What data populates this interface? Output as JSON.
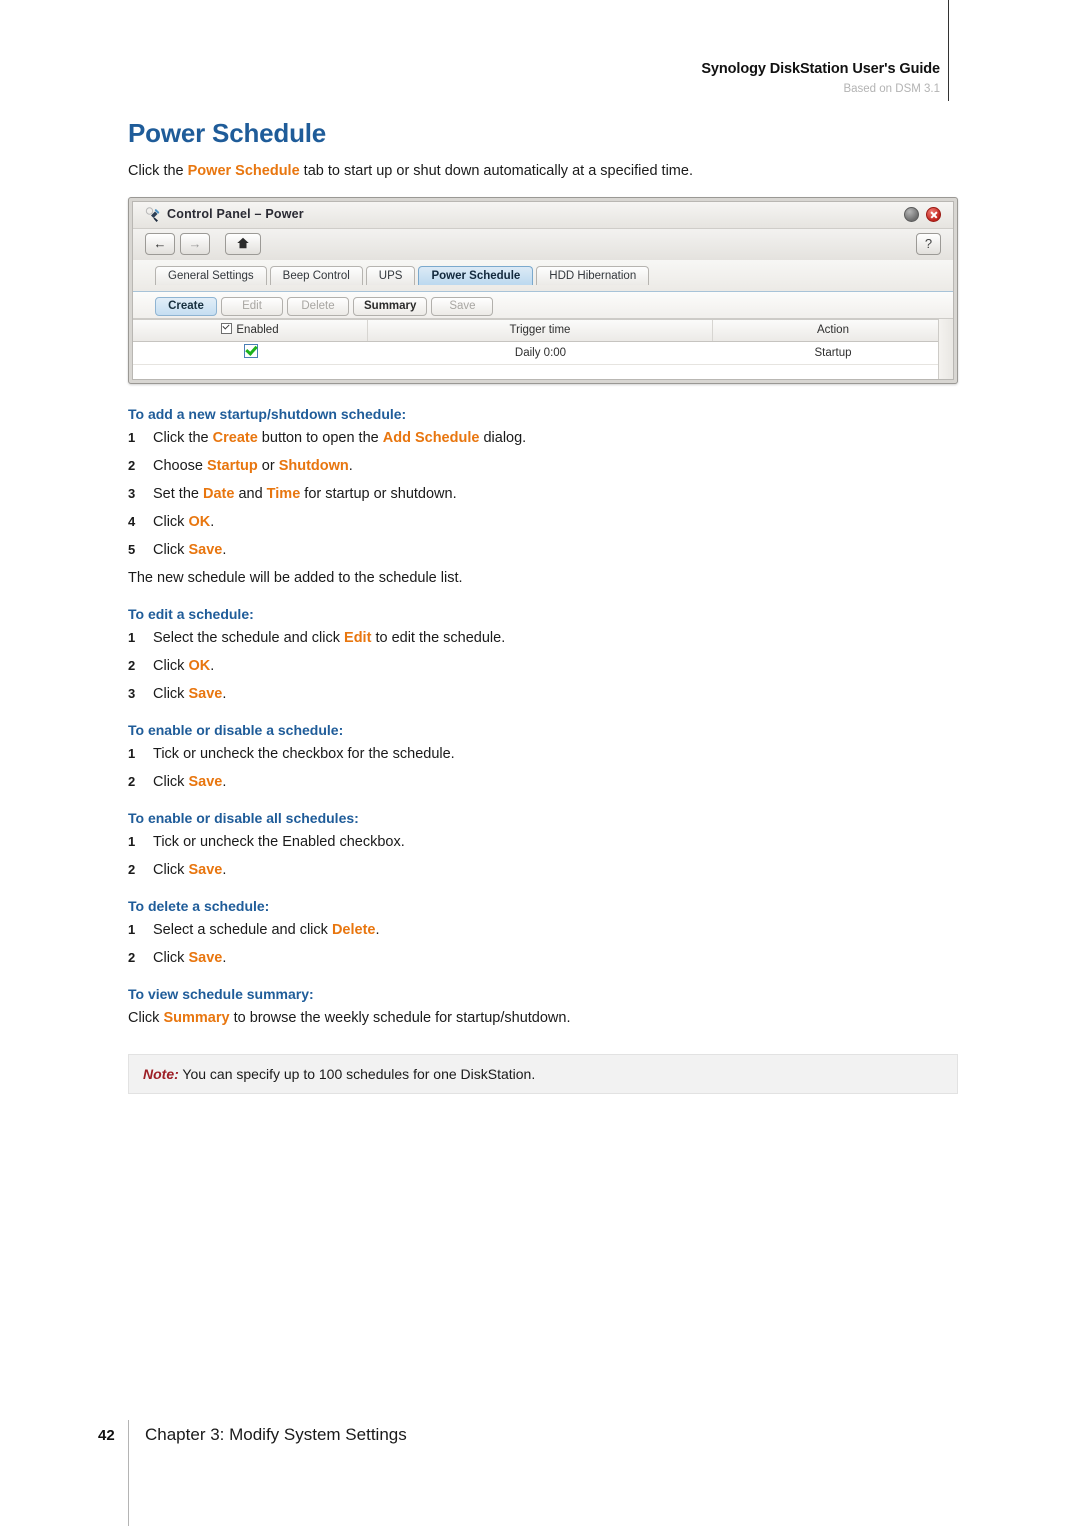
{
  "header": {
    "title": "Synology DiskStation User's Guide",
    "subtitle": "Based on DSM 3.1"
  },
  "page": {
    "title": "Power Schedule",
    "intro_pre": "Click the ",
    "intro_hl": "Power Schedule",
    "intro_post": " tab to start up or shut down automatically at a specified time."
  },
  "screenshot": {
    "window_title": "Control Panel – Power",
    "window_icon": "power-plug-icon",
    "nav": {
      "back": "←",
      "forward": "→",
      "home": "⌂",
      "help": "?"
    },
    "window_buttons": {
      "minimize": "minimize-icon",
      "close": "close-icon"
    },
    "tabs": [
      {
        "label": "General Settings",
        "active": false
      },
      {
        "label": "Beep Control",
        "active": false
      },
      {
        "label": "UPS",
        "active": false
      },
      {
        "label": "Power Schedule",
        "active": true
      },
      {
        "label": "HDD Hibernation",
        "active": false
      }
    ],
    "toolbar": [
      {
        "label": "Create",
        "state": "primary"
      },
      {
        "label": "Edit",
        "state": "disabled"
      },
      {
        "label": "Delete",
        "state": "disabled"
      },
      {
        "label": "Summary",
        "state": "bold"
      },
      {
        "label": "Save",
        "state": "disabled"
      }
    ],
    "grid": {
      "columns": [
        "Enabled",
        "Trigger time",
        "Action"
      ],
      "rows": [
        {
          "enabled": true,
          "trigger_time": "Daily 0:00",
          "action": "Startup"
        }
      ]
    }
  },
  "sections": [
    {
      "heading": "To add a new startup/shutdown schedule:",
      "steps": [
        {
          "num": "1",
          "parts": [
            {
              "t": "Click the ",
              "hl": false
            },
            {
              "t": "Create",
              "hl": true
            },
            {
              "t": " button to open the ",
              "hl": false
            },
            {
              "t": "Add Schedule",
              "hl": true
            },
            {
              "t": " dialog.",
              "hl": false
            }
          ]
        },
        {
          "num": "2",
          "parts": [
            {
              "t": "Choose ",
              "hl": false
            },
            {
              "t": "Startup",
              "hl": true
            },
            {
              "t": " or ",
              "hl": false
            },
            {
              "t": "Shutdown",
              "hl": true
            },
            {
              "t": ".",
              "hl": false
            }
          ]
        },
        {
          "num": "3",
          "parts": [
            {
              "t": "Set the ",
              "hl": false
            },
            {
              "t": "Date",
              "hl": true
            },
            {
              "t": " and ",
              "hl": false
            },
            {
              "t": "Time",
              "hl": true
            },
            {
              "t": " for startup or shutdown.",
              "hl": false
            }
          ]
        },
        {
          "num": "4",
          "parts": [
            {
              "t": "Click ",
              "hl": false
            },
            {
              "t": "OK",
              "hl": true
            },
            {
              "t": ".",
              "hl": false
            }
          ]
        },
        {
          "num": "5",
          "parts": [
            {
              "t": "Click ",
              "hl": false
            },
            {
              "t": "Save",
              "hl": true
            },
            {
              "t": ".",
              "hl": false
            }
          ]
        }
      ],
      "trailing_text": "The new schedule will be added to the schedule list."
    },
    {
      "heading": "To edit a schedule:",
      "steps": [
        {
          "num": "1",
          "parts": [
            {
              "t": "Select the schedule and click ",
              "hl": false
            },
            {
              "t": "Edit",
              "hl": true
            },
            {
              "t": " to edit the schedule.",
              "hl": false
            }
          ]
        },
        {
          "num": "2",
          "parts": [
            {
              "t": "Click ",
              "hl": false
            },
            {
              "t": "OK",
              "hl": true
            },
            {
              "t": ".",
              "hl": false
            }
          ]
        },
        {
          "num": "3",
          "parts": [
            {
              "t": "Click ",
              "hl": false
            },
            {
              "t": "Save",
              "hl": true
            },
            {
              "t": ".",
              "hl": false
            }
          ]
        }
      ],
      "trailing_text": ""
    },
    {
      "heading": "To enable or disable a schedule:",
      "steps": [
        {
          "num": "1",
          "parts": [
            {
              "t": "Tick or uncheck the checkbox for the schedule.",
              "hl": false
            }
          ]
        },
        {
          "num": "2",
          "parts": [
            {
              "t": "Click ",
              "hl": false
            },
            {
              "t": "Save",
              "hl": true
            },
            {
              "t": ".",
              "hl": false
            }
          ]
        }
      ],
      "trailing_text": ""
    },
    {
      "heading": "To enable or disable all schedules:",
      "steps": [
        {
          "num": "1",
          "parts": [
            {
              "t": "Tick or uncheck the Enabled checkbox.",
              "hl": false
            }
          ]
        },
        {
          "num": "2",
          "parts": [
            {
              "t": "Click ",
              "hl": false
            },
            {
              "t": "Save",
              "hl": true
            },
            {
              "t": ".",
              "hl": false
            }
          ]
        }
      ],
      "trailing_text": ""
    },
    {
      "heading": "To delete a schedule:",
      "steps": [
        {
          "num": "1",
          "parts": [
            {
              "t": "Select a schedule and click ",
              "hl": false
            },
            {
              "t": "Delete",
              "hl": true
            },
            {
              "t": ".",
              "hl": false
            }
          ]
        },
        {
          "num": "2",
          "parts": [
            {
              "t": "Click ",
              "hl": false
            },
            {
              "t": "Save",
              "hl": true
            },
            {
              "t": ".",
              "hl": false
            }
          ]
        }
      ],
      "trailing_text": ""
    },
    {
      "heading": "To view schedule summary:",
      "steps": [],
      "trailing_text_parts": [
        {
          "t": "Click ",
          "hl": false
        },
        {
          "t": "Summary",
          "hl": true
        },
        {
          "t": " to browse the weekly schedule for startup/shutdown.",
          "hl": false
        }
      ]
    }
  ],
  "note": {
    "label": "Note:",
    "text": " You can specify up to 100 schedules for one DiskStation."
  },
  "footer": {
    "page_number": "42",
    "chapter": "Chapter 3: Modify System Settings"
  },
  "colors": {
    "heading_blue": "#1f5c99",
    "accent_orange": "#e8760f",
    "note_red": "#9d1f26"
  }
}
